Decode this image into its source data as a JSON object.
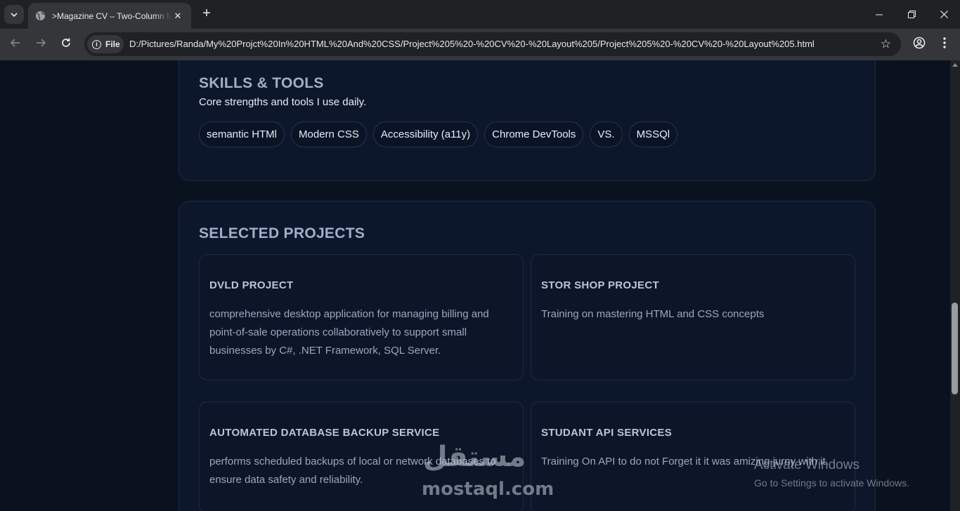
{
  "browser": {
    "tab_title": ">Magazine CV – Two-Column Magazine",
    "url_chip": "File",
    "url": "D:/Pictures/Randa/My%20Projct%20In%20HTML%20And%20CSS/Project%205%20-%20CV%20-%20Layout%205/Project%205%20-%20CV%20-%20Layout%205.html",
    "new_tab_glyph": "+",
    "tab_close_glyph": "✕",
    "star_glyph": "☆"
  },
  "skills": {
    "title": "SKILLS & TOOLS",
    "description": "Core strengths and tools I use daily.",
    "items": [
      "semantic HTMl",
      "Modern CSS",
      "Accessibility (a11y)",
      "Chrome DevTools",
      "VS.",
      "MSSQl"
    ]
  },
  "projects": {
    "title": "SELECTED PROJECTS",
    "items": [
      {
        "title": "DVLD PROJECT",
        "description": "comprehensive desktop application for managing billing and point-of-sale operations collaboratively to support small businesses by C#, .NET Framework, SQL Server."
      },
      {
        "title": "STOR SHOP PROJECT",
        "description": "Training on mastering HTML and CSS concepts"
      },
      {
        "title": "AUTOMATED DATABASE BACKUP SERVICE",
        "description": "performs scheduled backups of local or network databases to ensure data safety and reliability."
      },
      {
        "title": "STUDANT API SERVICES",
        "description": "Training On API to do not Forget it it was amizing jurny with it."
      }
    ]
  },
  "overlays": {
    "watermark_arabic": "مستقل",
    "watermark_latin": "mostaql.com",
    "activate_title": "Activate Windows",
    "activate_subtitle": "Go to Settings to activate Windows."
  }
}
